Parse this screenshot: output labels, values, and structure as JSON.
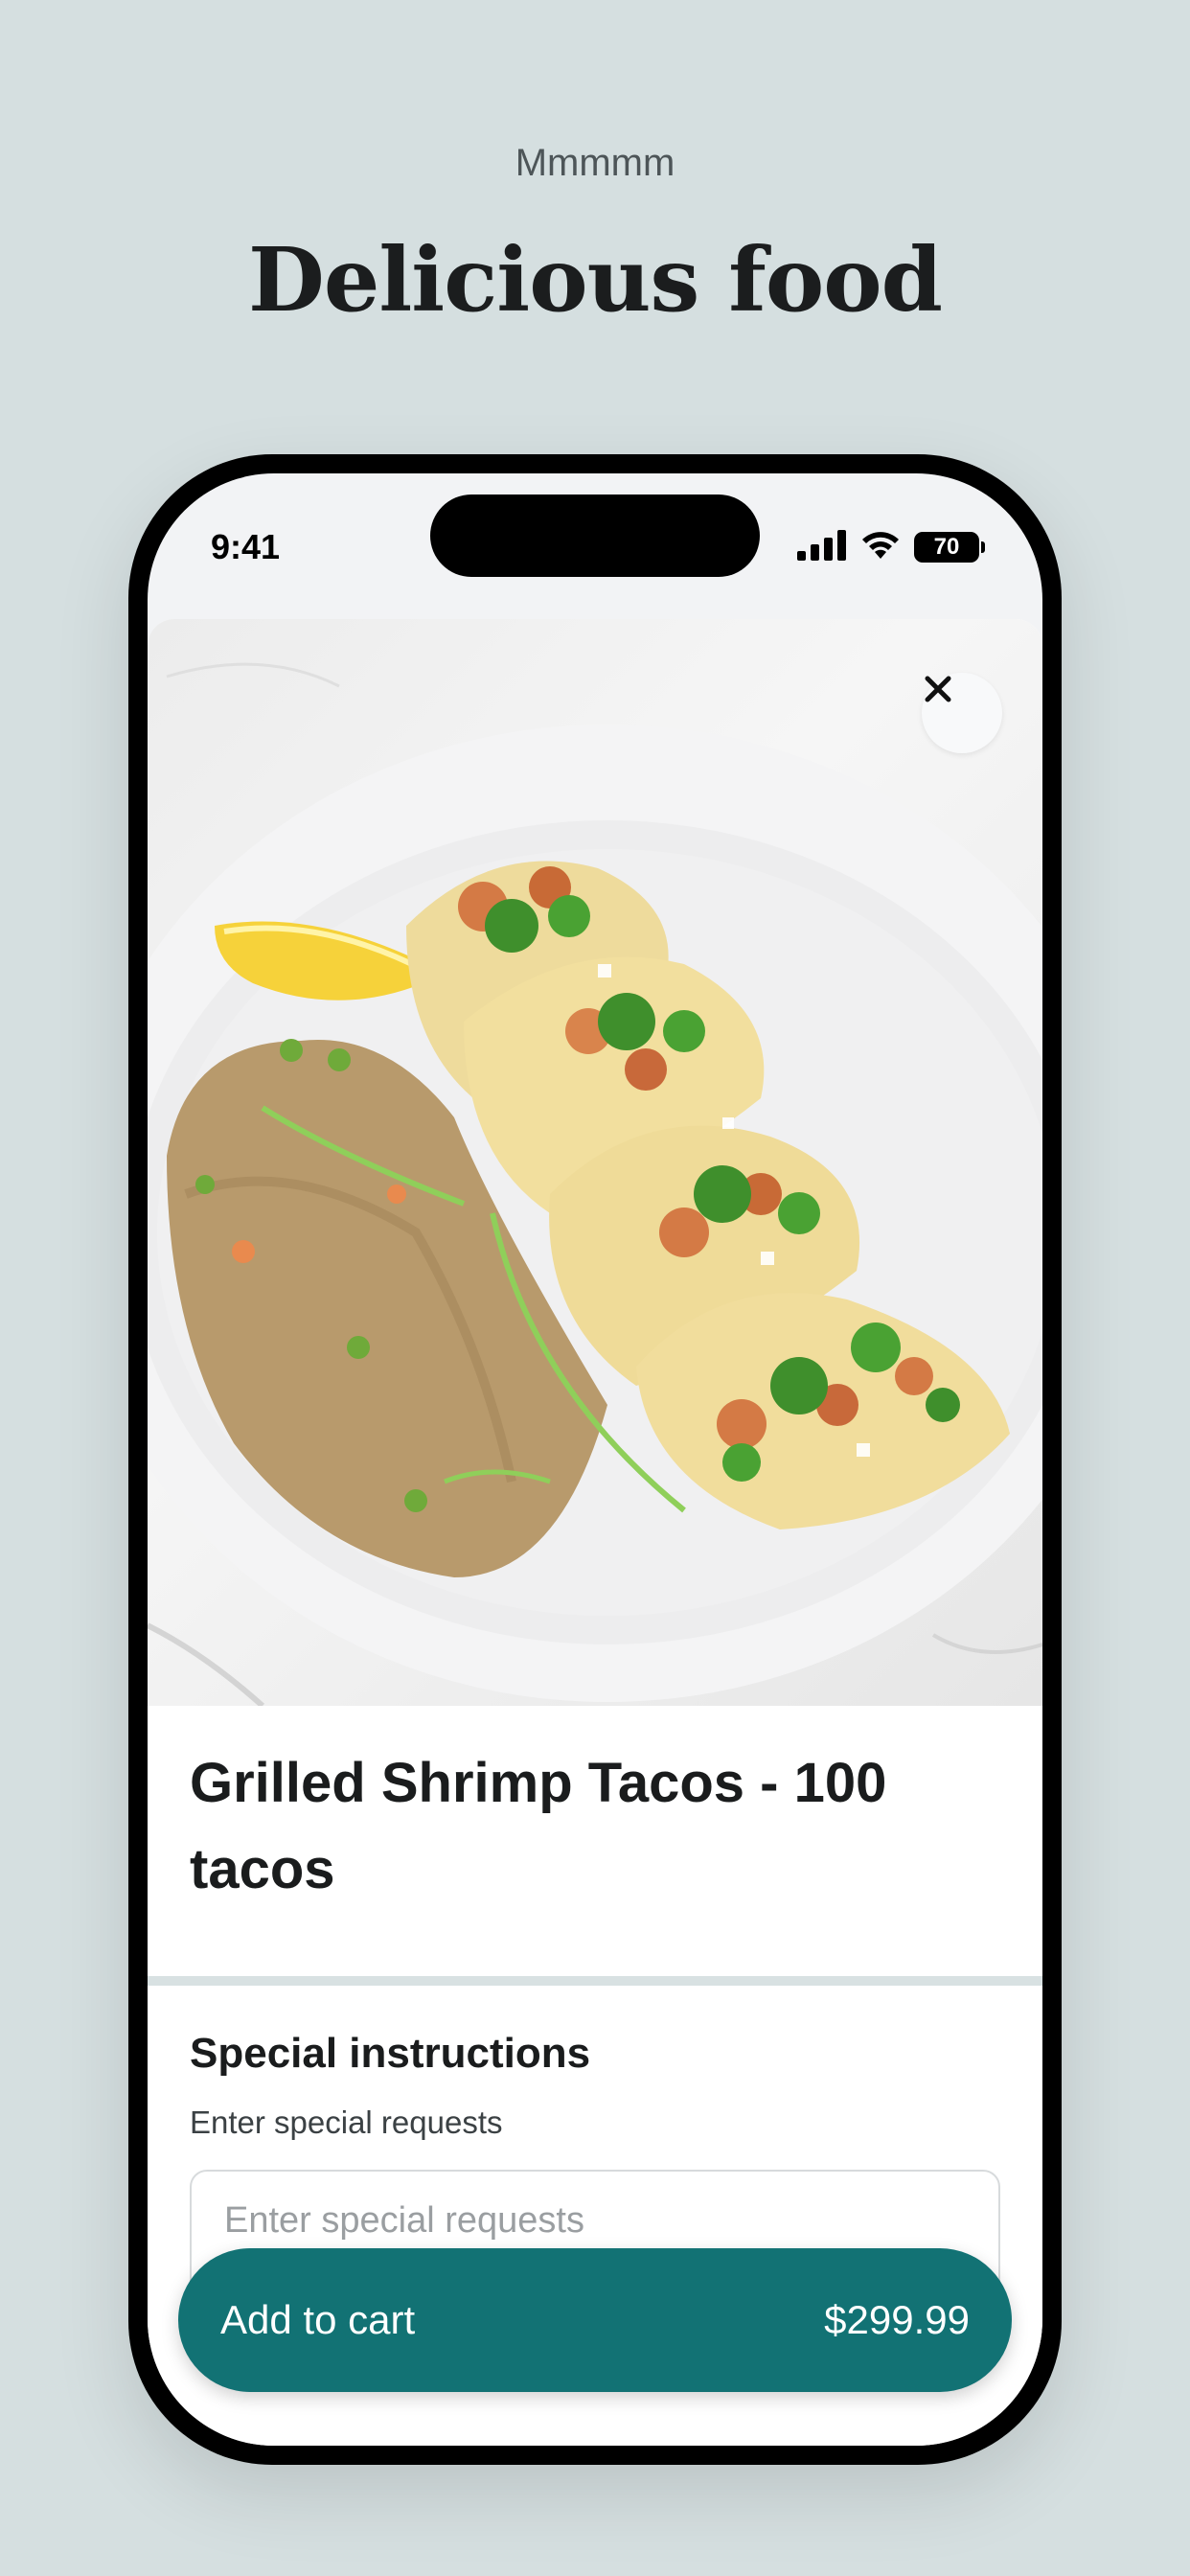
{
  "header": {
    "kicker": "Mmmmm",
    "title": "Delicious food"
  },
  "status_bar": {
    "time": "9:41",
    "battery": "70",
    "icons": [
      "signal-icon",
      "wifi-icon",
      "battery-icon"
    ]
  },
  "item": {
    "image_alt": "Grilled shrimp tacos with fried rice",
    "title": "Grilled Shrimp Tacos - 100 tacos",
    "close_icon": "close-icon"
  },
  "special_instructions": {
    "title": "Special instructions",
    "subtitle": "Enter special requests",
    "placeholder": "Enter special requests"
  },
  "cta": {
    "label": "Add to cart",
    "price": "$299.99",
    "color": "#127274"
  },
  "colors": {
    "background": "#d5dfe0",
    "accent": "#127274"
  }
}
